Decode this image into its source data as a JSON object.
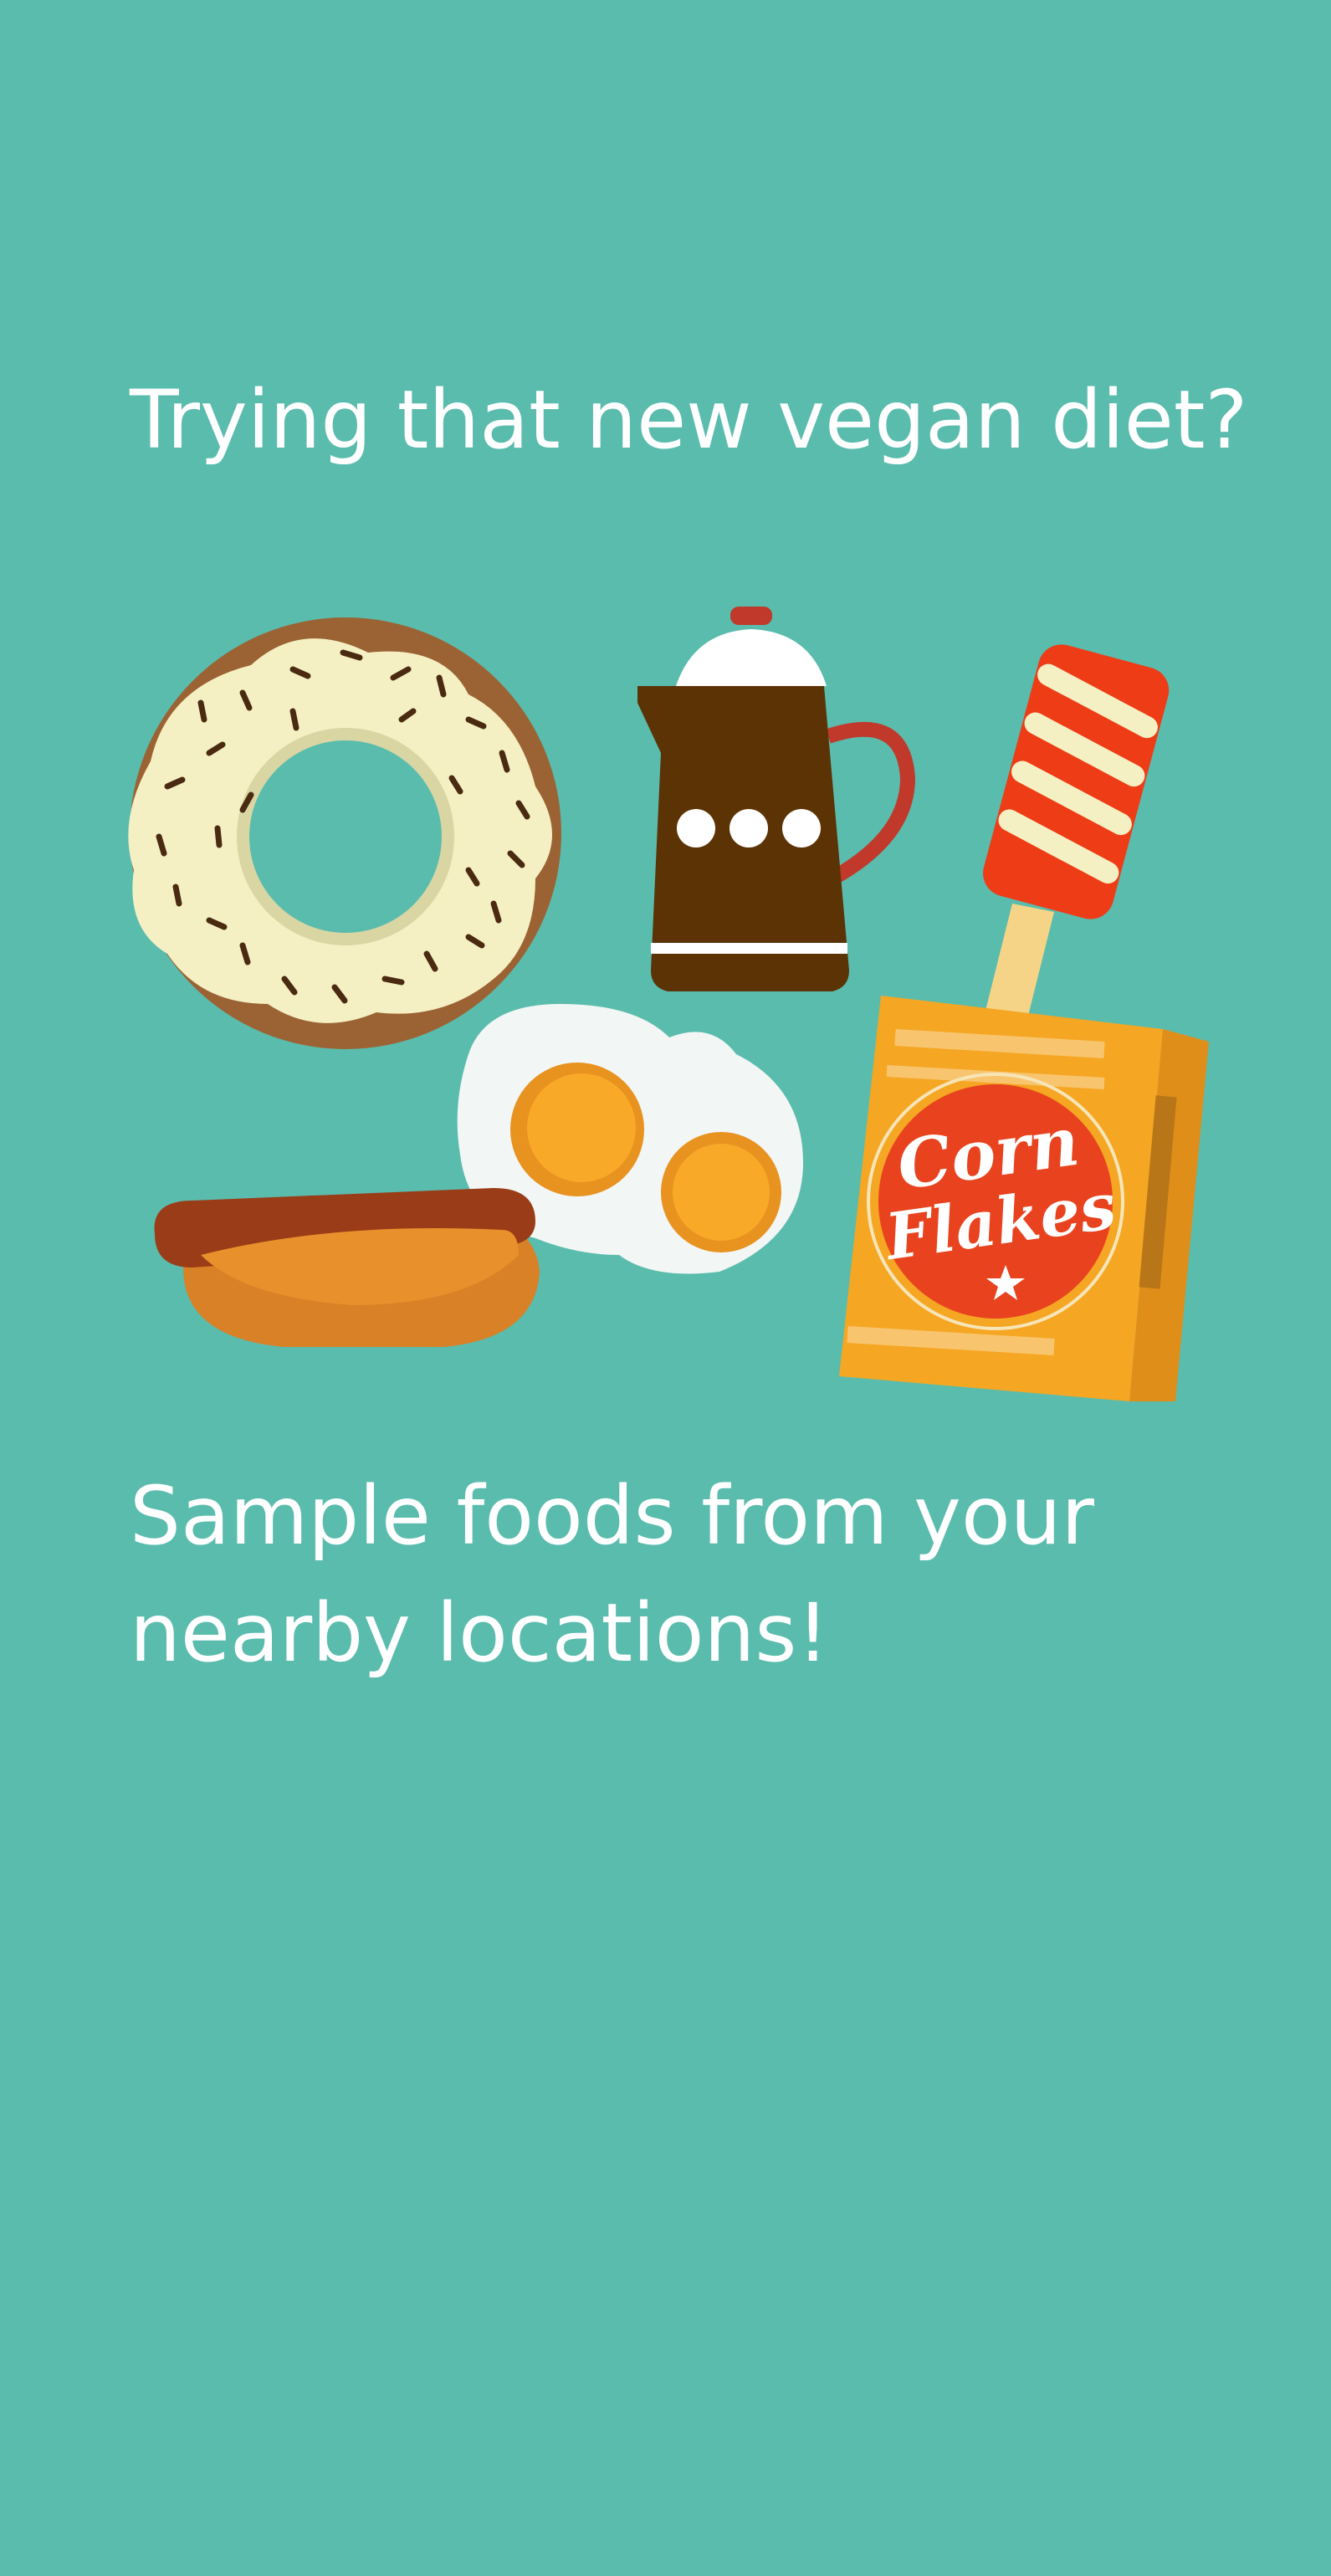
{
  "onboarding": {
    "headline": "Trying that new vegan diet?",
    "subline": "Sample foods from your nearby locations!",
    "cereal_box": {
      "brand_line1": "Corn",
      "brand_line2": "Flakes"
    }
  },
  "icons": [
    "donut-icon",
    "coffee-pot-icon",
    "popsicle-icon",
    "fried-eggs-icon",
    "hot-dog-icon",
    "cereal-box-icon"
  ],
  "colors": {
    "background": "#5abcad",
    "text": "#ffffff",
    "donut_dough": "#9b6333",
    "donut_icing": "#f5f0c4",
    "coffee_pot": "#5c3305",
    "popsicle_red": "#ee3c16",
    "egg_yolk": "#f9a928",
    "cereal_box": "#f5a623"
  }
}
